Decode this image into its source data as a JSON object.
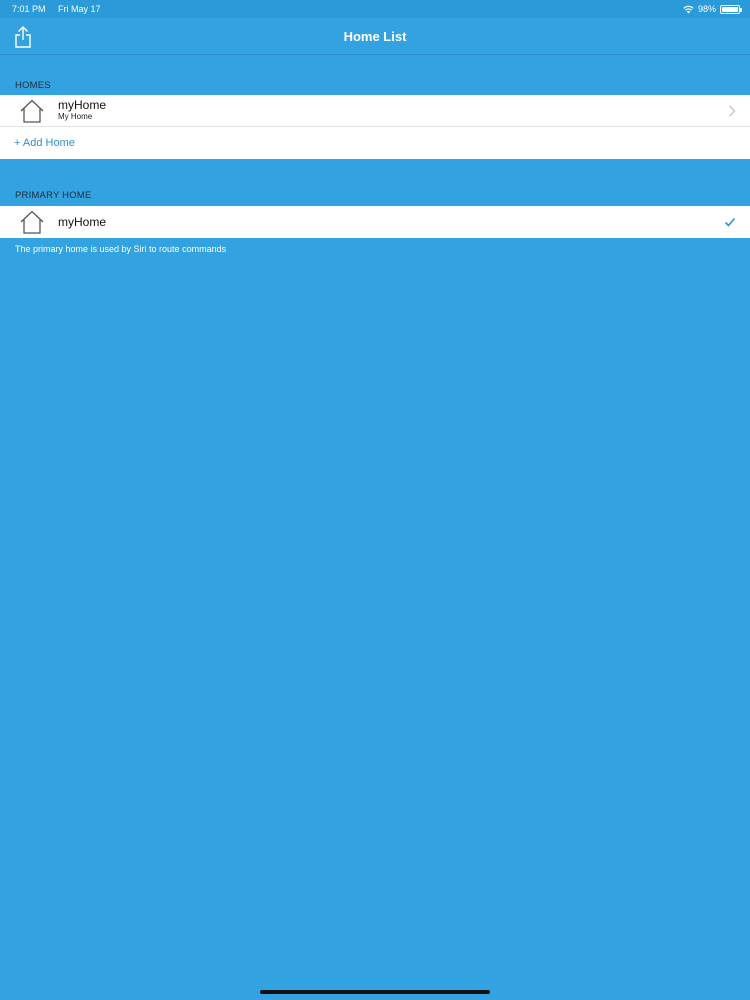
{
  "status_bar": {
    "time": "7:01 PM",
    "date": "Fri May 17",
    "battery": "98%",
    "battery_level": 0.98,
    "wifi_icon": "wifi-icon"
  },
  "nav": {
    "title": "Home List",
    "share_icon": "share-icon"
  },
  "homes_section": {
    "header": "HOMES",
    "items": [
      {
        "title": "myHome",
        "subtitle": "My Home",
        "icon": "house-icon"
      }
    ],
    "add_label": "+ Add Home"
  },
  "primary_section": {
    "header": "PRIMARY HOME",
    "items": [
      {
        "title": "myHome",
        "icon": "house-icon",
        "selected": true
      }
    ],
    "footer": "The primary home is used by Siri to route commands"
  },
  "colors": {
    "background": "#33a2e0",
    "accent": "#2f8fd6"
  }
}
